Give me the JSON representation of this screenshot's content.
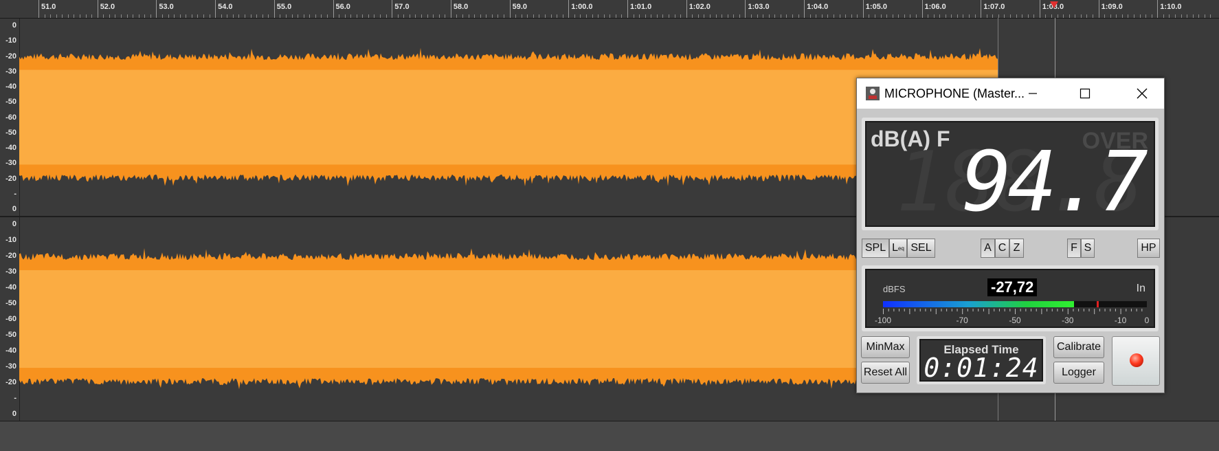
{
  "ruler": {
    "labels": [
      "51.0",
      "52.0",
      "53.0",
      "54.0",
      "55.0",
      "56.0",
      "57.0",
      "58.0",
      "59.0",
      "1:00.0",
      "1:01.0",
      "1:02.0",
      "1:03.0",
      "1:04.0",
      "1:05.0",
      "1:06.0",
      "1:07.0",
      "1:08.0",
      "1:09.0",
      "1:10.0"
    ]
  },
  "tracks": {
    "scale_labels": [
      "0",
      "-10",
      "-20",
      "-30",
      "-40",
      "-50",
      "-60",
      "-50",
      "-40",
      "-30",
      "-20",
      "-",
      "0"
    ]
  },
  "colors": {
    "waveform_dark": "#f7921e",
    "waveform_light": "#fbac42",
    "playhead": "#e03030"
  },
  "meter_window": {
    "title": "MICROPHONE (Master...",
    "unit_label": "dB(A) F",
    "over_label": "OVER",
    "level_value": "94.7",
    "ghost_value": "188.8",
    "buttons": {
      "spl": "SPL",
      "leq_main": "L",
      "leq_sub": "eq",
      "sel": "SEL",
      "weight_a": "A",
      "weight_c": "C",
      "weight_z": "Z",
      "time_f": "F",
      "time_s": "S",
      "hp": "HP"
    },
    "dbfs_meter": {
      "label": "dBFS",
      "readout": "-27,72",
      "input_label": "In",
      "level_dbfs": -27.72,
      "peak_dbfs": -19,
      "scale": [
        "-100",
        "-70",
        "-50",
        "-30",
        "-10",
        "0"
      ]
    },
    "controls": {
      "minmax": "MinMax",
      "reset_all": "Reset All",
      "elapsed_label": "Elapsed Time",
      "elapsed_value": "0:01:24",
      "calibrate": "Calibrate",
      "logger": "Logger"
    }
  }
}
